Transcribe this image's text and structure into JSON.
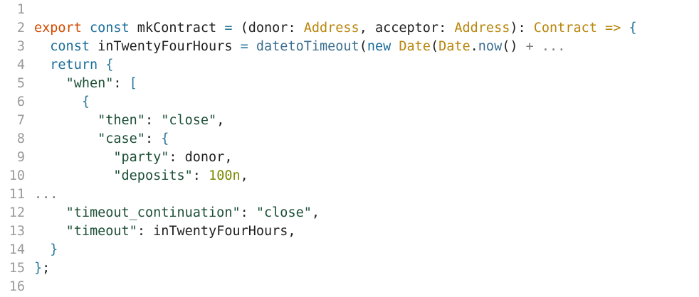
{
  "code": {
    "lines": [
      {
        "num": "1",
        "tokens": []
      },
      {
        "num": "2",
        "tokens": [
          {
            "t": "export",
            "c": "kw"
          },
          {
            "t": " "
          },
          {
            "t": "const",
            "c": "key"
          },
          {
            "t": " mkContract "
          },
          {
            "t": "=",
            "c": "punc"
          },
          {
            "t": " ("
          },
          {
            "t": "donor"
          },
          {
            "t": ": "
          },
          {
            "t": "Address",
            "c": "type"
          },
          {
            "t": ", "
          },
          {
            "t": "acceptor"
          },
          {
            "t": ": "
          },
          {
            "t": "Address",
            "c": "type"
          },
          {
            "t": "): "
          },
          {
            "t": "Contract",
            "c": "type"
          },
          {
            "t": " "
          },
          {
            "t": "=>",
            "c": "type"
          },
          {
            "t": " "
          },
          {
            "t": "{",
            "c": "punc"
          }
        ]
      },
      {
        "num": "3",
        "tokens": [
          {
            "t": "  "
          },
          {
            "t": "const",
            "c": "key"
          },
          {
            "t": " inTwentyFourHours "
          },
          {
            "t": "=",
            "c": "punc"
          },
          {
            "t": " "
          },
          {
            "t": "datetoTimeout",
            "c": "func"
          },
          {
            "t": "("
          },
          {
            "t": "new",
            "c": "key"
          },
          {
            "t": " "
          },
          {
            "t": "Date",
            "c": "type"
          },
          {
            "t": "("
          },
          {
            "t": "Date",
            "c": "type"
          },
          {
            "t": "."
          },
          {
            "t": "now",
            "c": "func"
          },
          {
            "t": "()"
          },
          {
            "t": " + ...",
            "c": "ellipsis"
          }
        ]
      },
      {
        "num": "4",
        "tokens": [
          {
            "t": "  "
          },
          {
            "t": "return",
            "c": "key"
          },
          {
            "t": " "
          },
          {
            "t": "{",
            "c": "punc"
          }
        ]
      },
      {
        "num": "5",
        "tokens": [
          {
            "t": "    "
          },
          {
            "t": "\"when\"",
            "c": "str"
          },
          {
            "t": ": "
          },
          {
            "t": "[",
            "c": "punc"
          }
        ]
      },
      {
        "num": "6",
        "tokens": [
          {
            "t": "      "
          },
          {
            "t": "{",
            "c": "punc"
          }
        ]
      },
      {
        "num": "7",
        "tokens": [
          {
            "t": "        "
          },
          {
            "t": "\"then\"",
            "c": "str"
          },
          {
            "t": ": "
          },
          {
            "t": "\"close\"",
            "c": "str"
          },
          {
            "t": ","
          }
        ]
      },
      {
        "num": "8",
        "tokens": [
          {
            "t": "        "
          },
          {
            "t": "\"case\"",
            "c": "str"
          },
          {
            "t": ": "
          },
          {
            "t": "{",
            "c": "punc"
          }
        ]
      },
      {
        "num": "9",
        "tokens": [
          {
            "t": "          "
          },
          {
            "t": "\"party\"",
            "c": "str"
          },
          {
            "t": ": donor,"
          }
        ]
      },
      {
        "num": "10",
        "tokens": [
          {
            "t": "          "
          },
          {
            "t": "\"deposits\"",
            "c": "str"
          },
          {
            "t": ": "
          },
          {
            "t": "100n",
            "c": "num"
          },
          {
            "t": ","
          }
        ]
      },
      {
        "num": "11",
        "tokens": [
          {
            "t": "...",
            "c": "ellipsis"
          }
        ]
      },
      {
        "num": "12",
        "tokens": [
          {
            "t": "    "
          },
          {
            "t": "\"timeout_continuation\"",
            "c": "str"
          },
          {
            "t": ": "
          },
          {
            "t": "\"close\"",
            "c": "str"
          },
          {
            "t": ","
          }
        ]
      },
      {
        "num": "13",
        "tokens": [
          {
            "t": "    "
          },
          {
            "t": "\"timeout\"",
            "c": "str"
          },
          {
            "t": ": inTwentyFourHours,"
          }
        ]
      },
      {
        "num": "14",
        "tokens": [
          {
            "t": "  "
          },
          {
            "t": "}",
            "c": "punc"
          }
        ]
      },
      {
        "num": "15",
        "tokens": [
          {
            "t": "}",
            "c": "punc"
          },
          {
            "t": ";"
          }
        ]
      },
      {
        "num": "16",
        "tokens": []
      }
    ]
  }
}
